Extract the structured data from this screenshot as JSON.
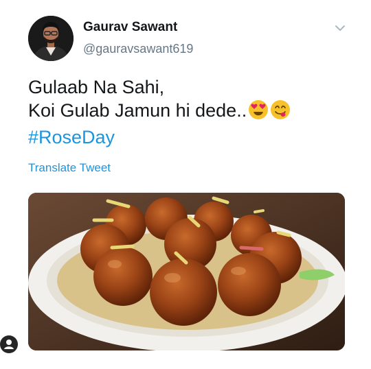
{
  "tweet": {
    "display_name": "Gaurav Sawant",
    "handle": "@gauravsawant619",
    "text_line_1": "Gulaab Na Sahi,",
    "text_line_2": "Koi Gulab Jamun hi dede..",
    "hashtag": "#RoseDay",
    "translate_label": "Translate Tweet"
  },
  "icons": {
    "caret": "chevron-down-icon",
    "emoji_1": "heart-eyes-emoji",
    "emoji_2": "yum-emoji",
    "profile": "profile-icon"
  },
  "colors": {
    "link": "#1b95e0",
    "name": "#14171a",
    "handle": "#657786"
  }
}
